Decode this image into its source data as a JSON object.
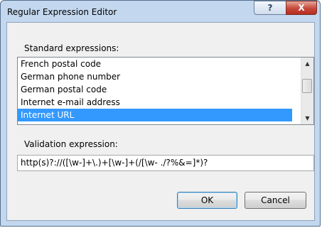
{
  "window": {
    "title": "Regular Expression Editor",
    "help_glyph": "?",
    "close_glyph": "X"
  },
  "standard": {
    "label": "Standard expressions:",
    "items": [
      "French postal code",
      "German phone number",
      "German postal code",
      "Internet e-mail address",
      "Internet URL"
    ],
    "selected_index": 4
  },
  "validation": {
    "label": "Validation expression:",
    "value": "http(s)?://([\\w-]+\\.)+[\\w-]+(/[\\w- ./?%&=]*)?"
  },
  "buttons": {
    "ok": "OK",
    "cancel": "Cancel"
  },
  "colors": {
    "selection": "#3399ff",
    "frame": "#c3d7ee",
    "close": "#c6483a"
  }
}
